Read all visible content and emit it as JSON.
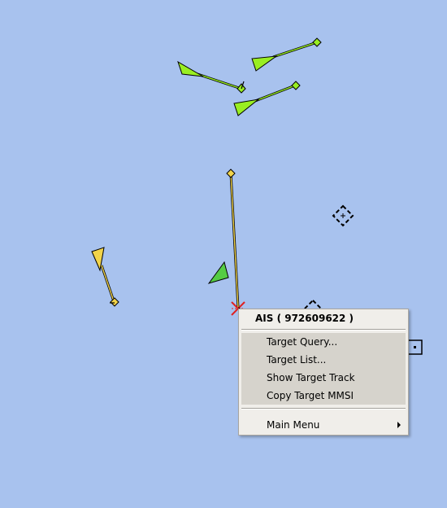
{
  "context_menu": {
    "title": "AIS ( 972609622 )",
    "items": [
      {
        "label": "Target Query..."
      },
      {
        "label": "Target List..."
      },
      {
        "label": "Show Target Track"
      },
      {
        "label": "Copy Target MMSI"
      }
    ],
    "main_menu_label": "Main Menu"
  },
  "colors": {
    "sea": "#a8c2ee",
    "ais_target_active": "#99ee22",
    "ais_target_selected": "#f2d44a",
    "ais_target_sleeping": "#55cc44",
    "cursor_cross": "#e02020"
  }
}
